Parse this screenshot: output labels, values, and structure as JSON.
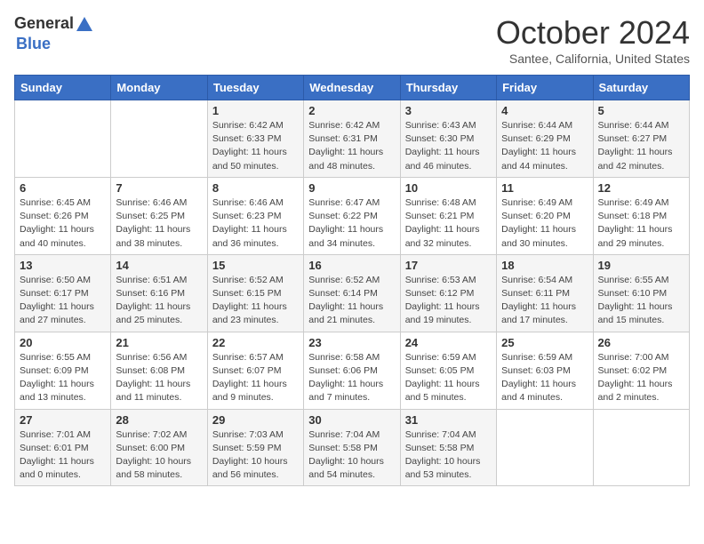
{
  "header": {
    "logo_general": "General",
    "logo_blue": "Blue",
    "title": "October 2024",
    "subtitle": "Santee, California, United States"
  },
  "days_of_week": [
    "Sunday",
    "Monday",
    "Tuesday",
    "Wednesday",
    "Thursday",
    "Friday",
    "Saturday"
  ],
  "weeks": [
    [
      {
        "day": "",
        "info": ""
      },
      {
        "day": "",
        "info": ""
      },
      {
        "day": "1",
        "info": "Sunrise: 6:42 AM\nSunset: 6:33 PM\nDaylight: 11 hours and 50 minutes."
      },
      {
        "day": "2",
        "info": "Sunrise: 6:42 AM\nSunset: 6:31 PM\nDaylight: 11 hours and 48 minutes."
      },
      {
        "day": "3",
        "info": "Sunrise: 6:43 AM\nSunset: 6:30 PM\nDaylight: 11 hours and 46 minutes."
      },
      {
        "day": "4",
        "info": "Sunrise: 6:44 AM\nSunset: 6:29 PM\nDaylight: 11 hours and 44 minutes."
      },
      {
        "day": "5",
        "info": "Sunrise: 6:44 AM\nSunset: 6:27 PM\nDaylight: 11 hours and 42 minutes."
      }
    ],
    [
      {
        "day": "6",
        "info": "Sunrise: 6:45 AM\nSunset: 6:26 PM\nDaylight: 11 hours and 40 minutes."
      },
      {
        "day": "7",
        "info": "Sunrise: 6:46 AM\nSunset: 6:25 PM\nDaylight: 11 hours and 38 minutes."
      },
      {
        "day": "8",
        "info": "Sunrise: 6:46 AM\nSunset: 6:23 PM\nDaylight: 11 hours and 36 minutes."
      },
      {
        "day": "9",
        "info": "Sunrise: 6:47 AM\nSunset: 6:22 PM\nDaylight: 11 hours and 34 minutes."
      },
      {
        "day": "10",
        "info": "Sunrise: 6:48 AM\nSunset: 6:21 PM\nDaylight: 11 hours and 32 minutes."
      },
      {
        "day": "11",
        "info": "Sunrise: 6:49 AM\nSunset: 6:20 PM\nDaylight: 11 hours and 30 minutes."
      },
      {
        "day": "12",
        "info": "Sunrise: 6:49 AM\nSunset: 6:18 PM\nDaylight: 11 hours and 29 minutes."
      }
    ],
    [
      {
        "day": "13",
        "info": "Sunrise: 6:50 AM\nSunset: 6:17 PM\nDaylight: 11 hours and 27 minutes."
      },
      {
        "day": "14",
        "info": "Sunrise: 6:51 AM\nSunset: 6:16 PM\nDaylight: 11 hours and 25 minutes."
      },
      {
        "day": "15",
        "info": "Sunrise: 6:52 AM\nSunset: 6:15 PM\nDaylight: 11 hours and 23 minutes."
      },
      {
        "day": "16",
        "info": "Sunrise: 6:52 AM\nSunset: 6:14 PM\nDaylight: 11 hours and 21 minutes."
      },
      {
        "day": "17",
        "info": "Sunrise: 6:53 AM\nSunset: 6:12 PM\nDaylight: 11 hours and 19 minutes."
      },
      {
        "day": "18",
        "info": "Sunrise: 6:54 AM\nSunset: 6:11 PM\nDaylight: 11 hours and 17 minutes."
      },
      {
        "day": "19",
        "info": "Sunrise: 6:55 AM\nSunset: 6:10 PM\nDaylight: 11 hours and 15 minutes."
      }
    ],
    [
      {
        "day": "20",
        "info": "Sunrise: 6:55 AM\nSunset: 6:09 PM\nDaylight: 11 hours and 13 minutes."
      },
      {
        "day": "21",
        "info": "Sunrise: 6:56 AM\nSunset: 6:08 PM\nDaylight: 11 hours and 11 minutes."
      },
      {
        "day": "22",
        "info": "Sunrise: 6:57 AM\nSunset: 6:07 PM\nDaylight: 11 hours and 9 minutes."
      },
      {
        "day": "23",
        "info": "Sunrise: 6:58 AM\nSunset: 6:06 PM\nDaylight: 11 hours and 7 minutes."
      },
      {
        "day": "24",
        "info": "Sunrise: 6:59 AM\nSunset: 6:05 PM\nDaylight: 11 hours and 5 minutes."
      },
      {
        "day": "25",
        "info": "Sunrise: 6:59 AM\nSunset: 6:03 PM\nDaylight: 11 hours and 4 minutes."
      },
      {
        "day": "26",
        "info": "Sunrise: 7:00 AM\nSunset: 6:02 PM\nDaylight: 11 hours and 2 minutes."
      }
    ],
    [
      {
        "day": "27",
        "info": "Sunrise: 7:01 AM\nSunset: 6:01 PM\nDaylight: 11 hours and 0 minutes."
      },
      {
        "day": "28",
        "info": "Sunrise: 7:02 AM\nSunset: 6:00 PM\nDaylight: 10 hours and 58 minutes."
      },
      {
        "day": "29",
        "info": "Sunrise: 7:03 AM\nSunset: 5:59 PM\nDaylight: 10 hours and 56 minutes."
      },
      {
        "day": "30",
        "info": "Sunrise: 7:04 AM\nSunset: 5:58 PM\nDaylight: 10 hours and 54 minutes."
      },
      {
        "day": "31",
        "info": "Sunrise: 7:04 AM\nSunset: 5:58 PM\nDaylight: 10 hours and 53 minutes."
      },
      {
        "day": "",
        "info": ""
      },
      {
        "day": "",
        "info": ""
      }
    ]
  ]
}
